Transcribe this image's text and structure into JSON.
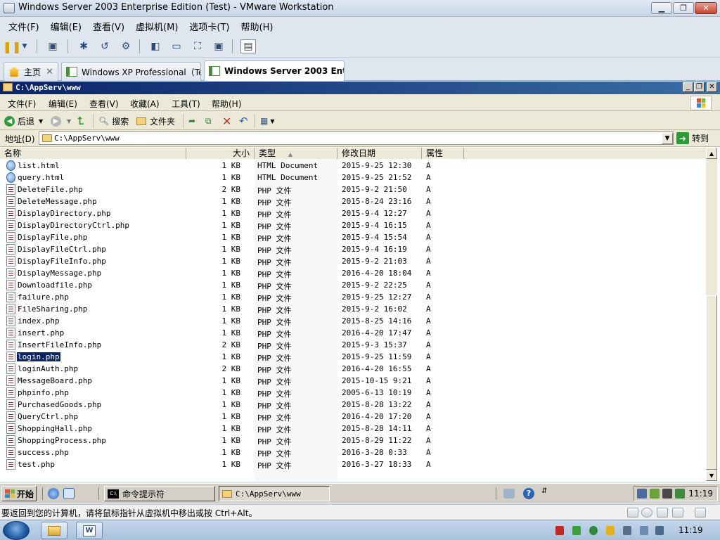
{
  "host": {
    "title": "Windows Server 2003 Enterprise Edition (Test) - VMware Workstation",
    "menus": [
      "文件(F)",
      "编辑(E)",
      "查看(V)",
      "虚拟机(M)",
      "选项卡(T)",
      "帮助(H)"
    ],
    "tabs": [
      {
        "label": "主页",
        "close": "✕",
        "icon": "home-icon"
      },
      {
        "label": "Windows XP Professional（Te…",
        "close": "✕",
        "icon": "vm-icon"
      },
      {
        "label": "Windows Server 2003 Ent…",
        "close": "✕",
        "icon": "vm-icon"
      }
    ],
    "status_text": "要返回到您的计算机，请将鼠标指针从虚拟机中移出或按 Ctrl+Alt。",
    "clock": "11:19"
  },
  "guest": {
    "title": "C:\\AppServ\\www",
    "menus": [
      "文件(F)",
      "编辑(E)",
      "查看(V)",
      "收藏(A)",
      "工具(T)",
      "帮助(H)"
    ],
    "toolbar": {
      "back": "后退",
      "search": "搜索",
      "folders": "文件夹"
    },
    "address": {
      "label": "地址(D)",
      "value": "C:\\AppServ\\www",
      "go": "转到"
    },
    "columns": {
      "name": "名称",
      "size": "大小",
      "type": "类型",
      "modified": "修改日期",
      "attr": "属性"
    },
    "files": [
      {
        "name": "list.html",
        "size": "1 KB",
        "type": "HTML Document",
        "modified": "2015-9-25 12:30",
        "attr": "A",
        "kind": "html"
      },
      {
        "name": "query.html",
        "size": "1 KB",
        "type": "HTML Document",
        "modified": "2015-9-25 21:52",
        "attr": "A",
        "kind": "html"
      },
      {
        "name": "DeleteFile.php",
        "size": "2 KB",
        "type": "PHP 文件",
        "modified": "2015-9-2 21:50",
        "attr": "A",
        "kind": "php"
      },
      {
        "name": "DeleteMessage.php",
        "size": "1 KB",
        "type": "PHP 文件",
        "modified": "2015-8-24 23:16",
        "attr": "A",
        "kind": "php"
      },
      {
        "name": "DisplayDirectory.php",
        "size": "1 KB",
        "type": "PHP 文件",
        "modified": "2015-9-4 12:27",
        "attr": "A",
        "kind": "php"
      },
      {
        "name": "DisplayDirectoryCtrl.php",
        "size": "1 KB",
        "type": "PHP 文件",
        "modified": "2015-9-4 16:15",
        "attr": "A",
        "kind": "php"
      },
      {
        "name": "DisplayFile.php",
        "size": "1 KB",
        "type": "PHP 文件",
        "modified": "2015-9-4 15:54",
        "attr": "A",
        "kind": "php"
      },
      {
        "name": "DisplayFileCtrl.php",
        "size": "1 KB",
        "type": "PHP 文件",
        "modified": "2015-9-4 16:19",
        "attr": "A",
        "kind": "php"
      },
      {
        "name": "DisplayFileInfo.php",
        "size": "1 KB",
        "type": "PHP 文件",
        "modified": "2015-9-2 21:03",
        "attr": "A",
        "kind": "php"
      },
      {
        "name": "DisplayMessage.php",
        "size": "1 KB",
        "type": "PHP 文件",
        "modified": "2016-4-20 18:04",
        "attr": "A",
        "kind": "php"
      },
      {
        "name": "Downloadfile.php",
        "size": "1 KB",
        "type": "PHP 文件",
        "modified": "2015-9-2 22:25",
        "attr": "A",
        "kind": "php"
      },
      {
        "name": "failure.php",
        "size": "1 KB",
        "type": "PHP 文件",
        "modified": "2015-9-25 12:27",
        "attr": "A",
        "kind": "php"
      },
      {
        "name": "FileSharing.php",
        "size": "1 KB",
        "type": "PHP 文件",
        "modified": "2015-9-2 16:02",
        "attr": "A",
        "kind": "php"
      },
      {
        "name": "index.php",
        "size": "1 KB",
        "type": "PHP 文件",
        "modified": "2015-8-25 14:16",
        "attr": "A",
        "kind": "php"
      },
      {
        "name": "insert.php",
        "size": "1 KB",
        "type": "PHP 文件",
        "modified": "2016-4-20 17:47",
        "attr": "A",
        "kind": "php"
      },
      {
        "name": "InsertFileInfo.php",
        "size": "2 KB",
        "type": "PHP 文件",
        "modified": "2015-9-3 15:37",
        "attr": "A",
        "kind": "php"
      },
      {
        "name": "login.php",
        "size": "1 KB",
        "type": "PHP 文件",
        "modified": "2015-9-25 11:59",
        "attr": "A",
        "kind": "php",
        "selected": true
      },
      {
        "name": "loginAuth.php",
        "size": "2 KB",
        "type": "PHP 文件",
        "modified": "2016-4-20 16:55",
        "attr": "A",
        "kind": "php"
      },
      {
        "name": "MessageBoard.php",
        "size": "1 KB",
        "type": "PHP 文件",
        "modified": "2015-10-15 9:21",
        "attr": "A",
        "kind": "php"
      },
      {
        "name": "phpinfo.php",
        "size": "1 KB",
        "type": "PHP 文件",
        "modified": "2005-6-13 10:19",
        "attr": "A",
        "kind": "php"
      },
      {
        "name": "PurchasedGoods.php",
        "size": "1 KB",
        "type": "PHP 文件",
        "modified": "2015-8-28 13:22",
        "attr": "A",
        "kind": "php"
      },
      {
        "name": "QueryCtrl.php",
        "size": "1 KB",
        "type": "PHP 文件",
        "modified": "2016-4-20 17:20",
        "attr": "A",
        "kind": "php"
      },
      {
        "name": "ShoppingHall.php",
        "size": "1 KB",
        "type": "PHP 文件",
        "modified": "2015-8-28 14:11",
        "attr": "A",
        "kind": "php"
      },
      {
        "name": "ShoppingProcess.php",
        "size": "1 KB",
        "type": "PHP 文件",
        "modified": "2015-8-29 11:22",
        "attr": "A",
        "kind": "php"
      },
      {
        "name": "success.php",
        "size": "1 KB",
        "type": "PHP 文件",
        "modified": "2016-3-28 0:33",
        "attr": "A",
        "kind": "php"
      },
      {
        "name": "test.php",
        "size": "1 KB",
        "type": "PHP 文件",
        "modified": "2016-3-27 18:33",
        "attr": "A",
        "kind": "php"
      }
    ],
    "taskbar": {
      "start": "开始",
      "tasks": [
        "命令提示符",
        "C:\\AppServ\\www"
      ],
      "clock": "11:19"
    }
  },
  "colors": {
    "guest_title_start": "#0a246a",
    "guest_title_end": "#3a6ea5",
    "selection": "#0a246a",
    "go_green": "#2b9a37"
  }
}
